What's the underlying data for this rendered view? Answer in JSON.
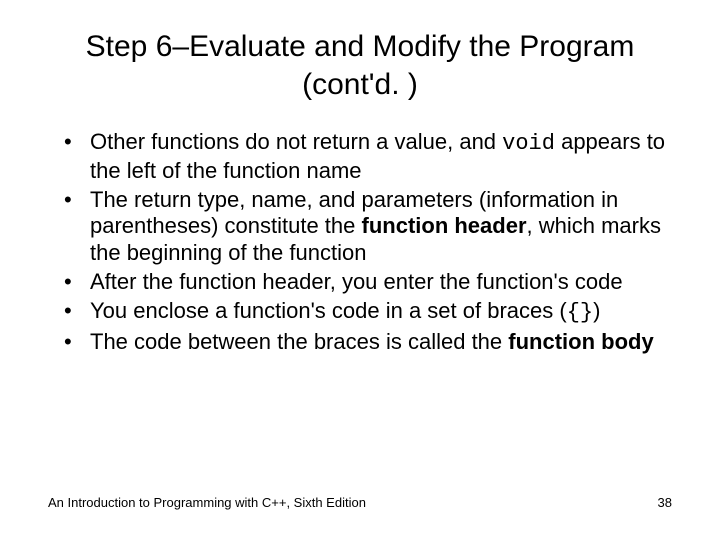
{
  "title": "Step 6–Evaluate and Modify the Program (cont'd. )",
  "bullets": {
    "b1_pre": "Other functions do not return a value, and ",
    "b1_code": "void",
    "b1_post": " appears to the left of the function name",
    "b2_pre": "The return type, name, and parameters (information in parentheses) constitute the ",
    "b2_bold": "function header",
    "b2_post": ", which marks the beginning of the function",
    "b3": "After the function header, you enter the function's code",
    "b4_pre": "You enclose a function's code in a set of braces (",
    "b4_code": "{}",
    "b4_post": ")",
    "b5_pre": "The code between the braces is called the ",
    "b5_bold": "function body"
  },
  "footer": {
    "left": "An Introduction to Programming with C++, Sixth Edition",
    "right": "38"
  }
}
